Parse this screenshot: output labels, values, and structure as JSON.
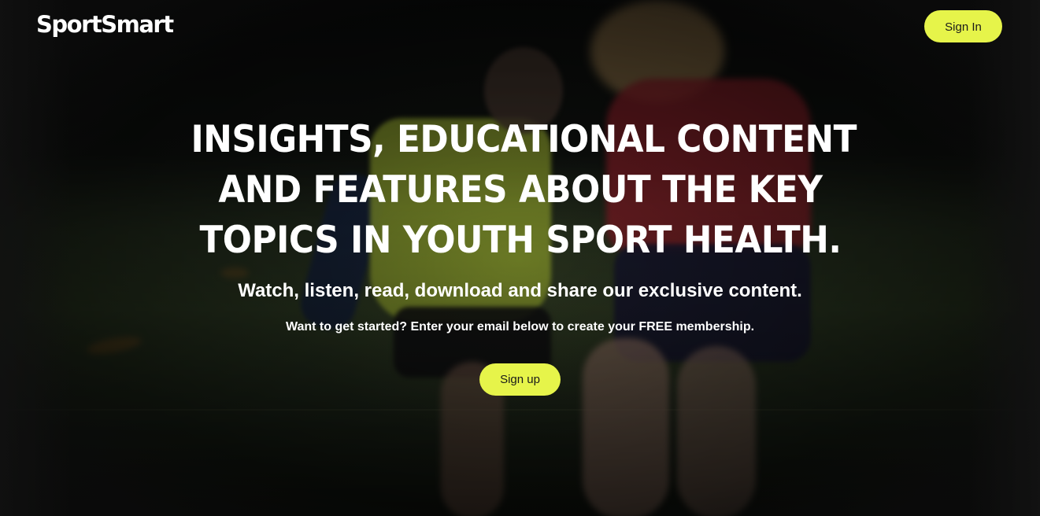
{
  "brand": {
    "logo_text": "SportSmart"
  },
  "header": {
    "signin_label": "Sign In"
  },
  "hero": {
    "headline_lines": [
      "INSIGHTS, EDUCATIONAL CONTENT",
      "AND FEATURES ABOUT THE KEY",
      "TOPICS IN YOUTH SPORT HEALTH."
    ],
    "subheadline": "Watch, listen, read, download and share our exclusive content.",
    "cta_text": "Want to get started? Enter your email below to create your FREE membership.",
    "signup_label": "Sign up"
  },
  "colors": {
    "accent": "#e6f44a",
    "background": "#141414",
    "text": "#ffffff"
  }
}
